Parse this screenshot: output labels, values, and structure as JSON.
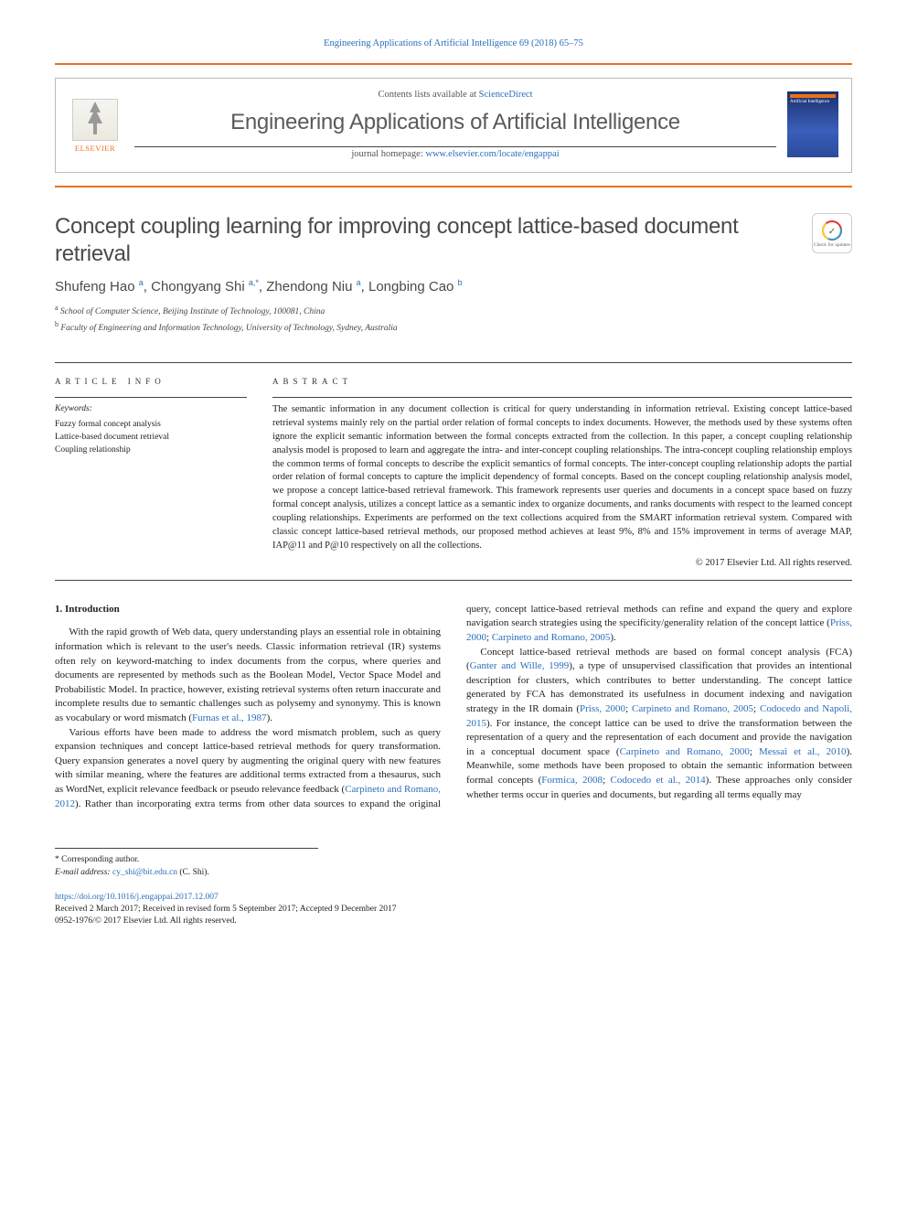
{
  "header": {
    "citation": "Engineering Applications of Artificial Intelligence 69 (2018) 65–75",
    "contents_line_prefix": "Contents lists available at ",
    "contents_link": "ScienceDirect",
    "journal_name": "Engineering Applications of Artificial Intelligence",
    "homepage_prefix": "journal homepage: ",
    "homepage_url": "www.elsevier.com/locate/engappai",
    "publisher": "ELSEVIER",
    "cover_text": "Artificial Intelligence"
  },
  "check_updates": "Check for updates",
  "article": {
    "title": "Concept coupling learning for improving concept lattice-based document retrieval",
    "authors_html": "Shufeng Hao",
    "authors": [
      {
        "name": "Shufeng Hao",
        "sup": "a"
      },
      {
        "name": "Chongyang Shi",
        "sup": "a,*"
      },
      {
        "name": "Zhendong Niu",
        "sup": "a"
      },
      {
        "name": "Longbing Cao",
        "sup": "b"
      }
    ],
    "affiliations": [
      {
        "sup": "a",
        "text": "School of Computer Science, Beijing Institute of Technology, 100081, China"
      },
      {
        "sup": "b",
        "text": "Faculty of Engineering and Information Technology, University of Technology, Sydney, Australia"
      }
    ]
  },
  "info": {
    "heading": "ARTICLE INFO",
    "keywords_label": "Keywords:",
    "keywords": [
      "Fuzzy formal concept analysis",
      "Lattice-based document retrieval",
      "Coupling relationship"
    ]
  },
  "abstract": {
    "heading": "ABSTRACT",
    "text": "The semantic information in any document collection is critical for query understanding in information retrieval. Existing concept lattice-based retrieval systems mainly rely on the partial order relation of formal concepts to index documents. However, the methods used by these systems often ignore the explicit semantic information between the formal concepts extracted from the collection. In this paper, a concept coupling relationship analysis model is proposed to learn and aggregate the intra- and inter-concept coupling relationships. The intra-concept coupling relationship employs the common terms of formal concepts to describe the explicit semantics of formal concepts. The inter-concept coupling relationship adopts the partial order relation of formal concepts to capture the implicit dependency of formal concepts. Based on the concept coupling relationship analysis model, we propose a concept lattice-based retrieval framework. This framework represents user queries and documents in a concept space based on fuzzy formal concept analysis, utilizes a concept lattice as a semantic index to organize documents, and ranks documents with respect to the learned concept coupling relationships. Experiments are performed on the text collections acquired from the SMART information retrieval system. Compared with classic concept lattice-based retrieval methods, our proposed method achieves at least 9%, 8% and 15% improvement in terms of average MAP, IAP@11 and P@10 respectively on all the collections.",
    "copyright": "© 2017 Elsevier Ltd. All rights reserved."
  },
  "body": {
    "section_heading": "1. Introduction",
    "p1a": "With the rapid growth of Web data, query understanding plays an essential role in obtaining information which is relevant to the user's needs. Classic information retrieval (IR) systems often rely on keyword-matching to index documents from the corpus, where queries and documents are represented by methods such as the Boolean Model, Vector Space Model and Probabilistic Model. In practice, however, existing retrieval systems often return inaccurate and incomplete results due to semantic challenges such as polysemy and synonymy. This is known as vocabulary or word mismatch (",
    "p1_cite1": "Furnas et al., 1987",
    "p1b": ").",
    "p2a": "Various efforts have been made to address the word mismatch problem, such as query expansion techniques and concept lattice-based retrieval methods for query transformation. Query expansion generates a novel query by augmenting the original query with new features with similar meaning, where the features are additional terms extracted from a thesaurus, such as WordNet, explicit relevance feedback or pseudo relevance feedback (",
    "p2_cite1": "Carpineto and Romano, 2012",
    "p2b": "). Rather than incorporating extra terms from other data sources to expand the original query, concept lattice-based retrieval methods can refine and expand the query and explore navigation search strategies using the specificity/generality relation of the concept lattice (",
    "p2_cite2": "Priss, 2000",
    "p2c": "; ",
    "p2_cite3": "Carpineto and Romano, 2005",
    "p2d": ").",
    "p3a": "Concept lattice-based retrieval methods are based on formal concept analysis (FCA) (",
    "p3_cite1": "Ganter and Wille, 1999",
    "p3b": "), a type of unsupervised classification that provides an intentional description for clusters, which contributes to better understanding. The concept lattice generated by FCA has demonstrated its usefulness in document indexing and navigation strategy in the IR domain (",
    "p3_cite2": "Priss, 2000",
    "p3c": "; ",
    "p3_cite3": "Carpineto and Romano, 2005",
    "p3d": "; ",
    "p3_cite4": "Codocedo and Napoli, 2015",
    "p3e": "). For instance, the concept lattice can be used to drive the transformation between the representation of a query and the representation of each document and provide the navigation in a conceptual document space (",
    "p3_cite5": "Carpineto and Romano, 2000",
    "p3f": "; ",
    "p3_cite6": "Messai et al., 2010",
    "p3g": "). Meanwhile, some methods have been proposed to obtain the semantic information between formal concepts (",
    "p3_cite7": "Formica, 2008",
    "p3h": "; ",
    "p3_cite8": "Codocedo et al., 2014",
    "p3i": "). These approaches only consider whether terms occur in queries and documents, but regarding all terms equally may"
  },
  "footnotes": {
    "corresponding": "* Corresponding author.",
    "email_label": "E-mail address: ",
    "email": "cy_shi@bit.edu.cn",
    "email_suffix": " (C. Shi).",
    "doi": "https://doi.org/10.1016/j.engappai.2017.12.007",
    "received": "Received 2 March 2017; Received in revised form 5 September 2017; Accepted 9 December 2017",
    "issn_copyright": "0952-1976/© 2017 Elsevier Ltd. All rights reserved."
  }
}
